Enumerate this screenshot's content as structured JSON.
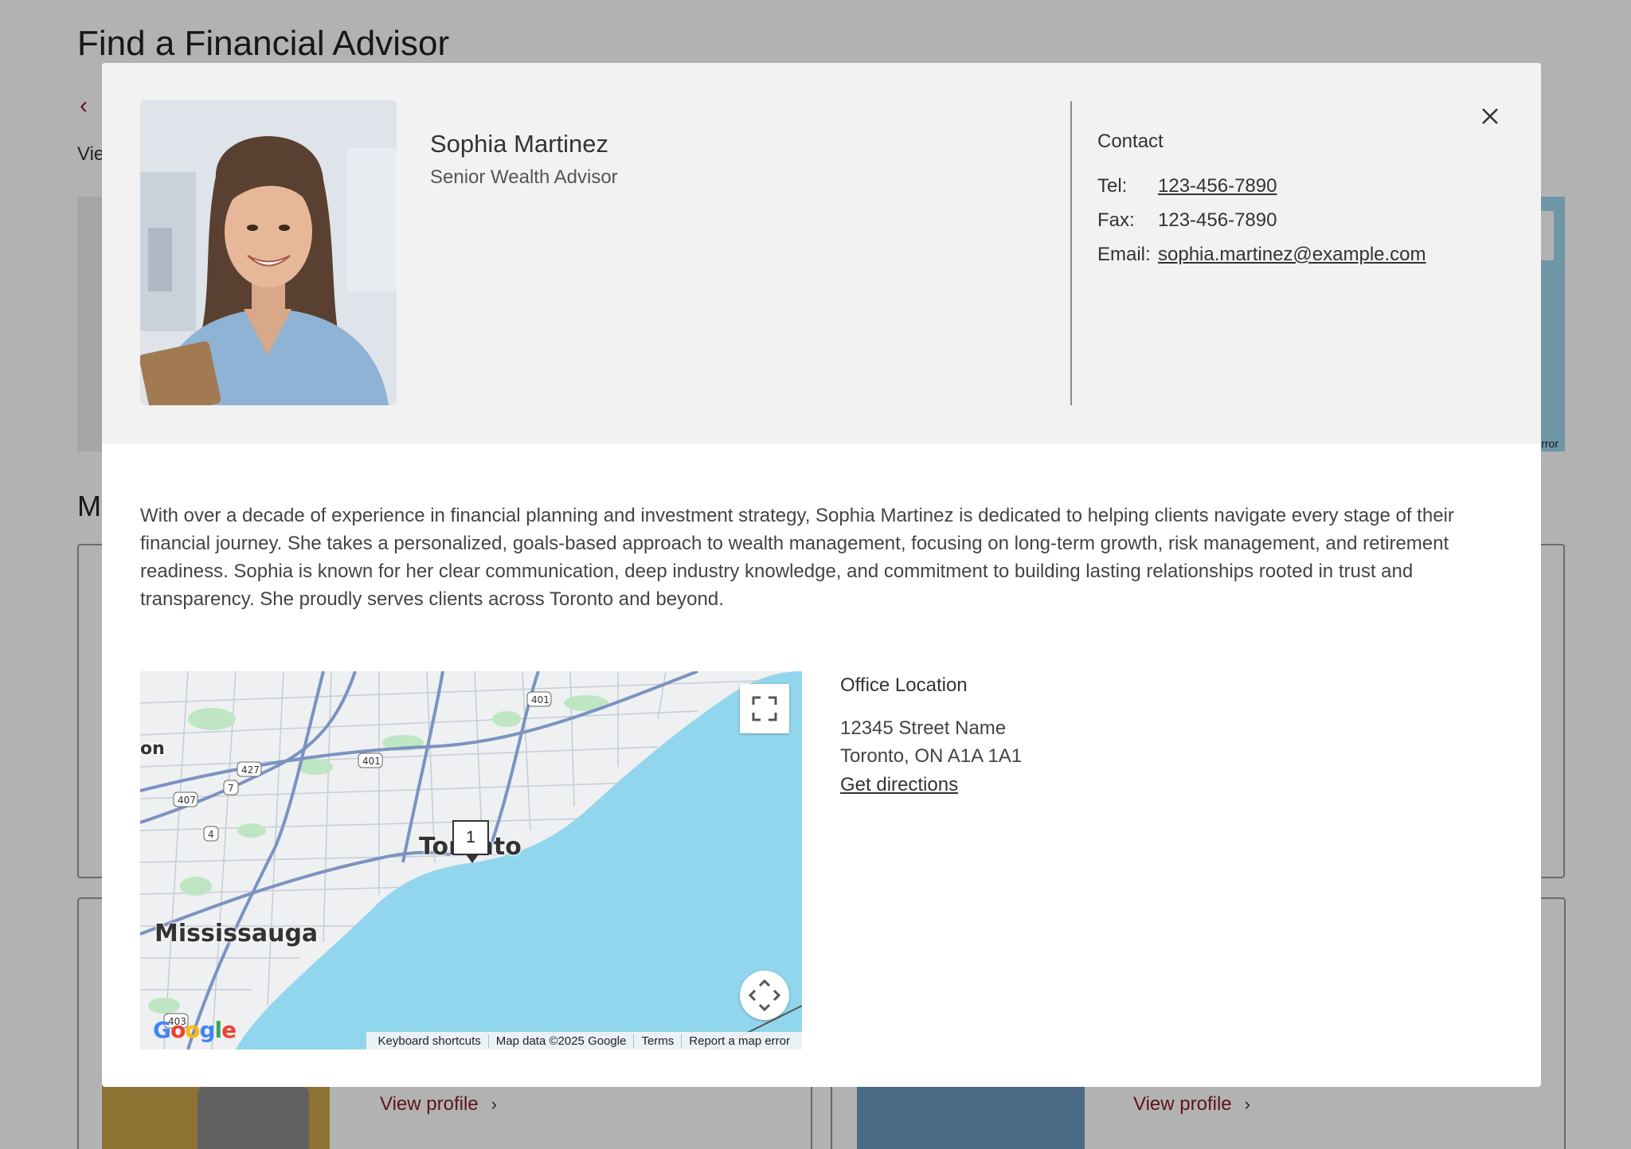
{
  "page": {
    "title": "Find a Financial Advisor",
    "back_label": "‹",
    "view_label": "Vie",
    "section_label": "M",
    "map_error_fragment": "rror",
    "cards": [
      {
        "link_label": "View profile"
      },
      {
        "link_label": "View profile"
      }
    ]
  },
  "modal": {
    "advisor": {
      "name": "Sophia Martinez",
      "title": "Senior Wealth Advisor",
      "photo_icon": "advisor-portrait"
    },
    "contact": {
      "heading": "Contact",
      "tel_label": "Tel:",
      "tel_value": "123-456-7890",
      "fax_label": "Fax:",
      "fax_value": "123-456-7890",
      "email_label": "Email:",
      "email_value": "sophia.martinez@example.com"
    },
    "close_icon": "close-icon",
    "bio": "With over a decade of experience in financial planning and investment strategy, Sophia Martinez is dedicated to helping clients navigate every stage of their financial journey. She takes a personalized, goals-based approach to wealth management, focusing on long-term growth, risk management, and retirement readiness. Sophia is known for her clear communication, deep industry knowledge, and commitment to building lasting relationships rooted in trust and transparency. She proudly serves clients across Toronto and beyond.",
    "map": {
      "labels": {
        "toronto": "Toronto",
        "mississauga": "Mississauga",
        "partial": "on"
      },
      "marker": "1",
      "highways": [
        "401",
        "401",
        "427",
        "407",
        "7",
        "4",
        "403"
      ],
      "attribution": [
        "Keyboard shortcuts",
        "Map data ©2025 Google",
        "Terms",
        "Report a map error"
      ],
      "logo": "Google",
      "colors": {
        "water": "#92d6ee",
        "land": "#eef0f2",
        "road": "#7b93c1",
        "park": "#bfe6c3"
      }
    },
    "office": {
      "heading": "Office Location",
      "street": "12345 Street Name",
      "city": "Toronto, ON A1A 1A1",
      "directions_label": "Get directions"
    }
  },
  "colors": {
    "accent": "#8a1c2c",
    "header_bg": "#f2f2f2",
    "overlay": "rgba(0,0,0,0.30)"
  }
}
